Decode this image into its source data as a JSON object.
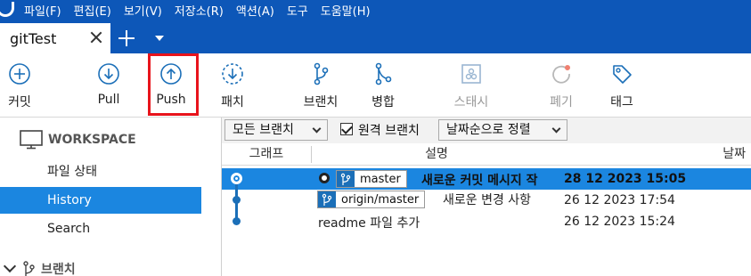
{
  "menu": {
    "items": [
      "파일(F)",
      "편집(E)",
      "보기(V)",
      "저장소(R)",
      "액션(A)",
      "도구",
      "도움말(H)"
    ]
  },
  "tabs": {
    "active_title": "gitTest"
  },
  "toolbar": {
    "commit": "커밋",
    "pull": "Pull",
    "push": "Push",
    "patch": "패치",
    "branch": "브랜치",
    "merge": "병합",
    "stash": "스태시",
    "discard": "폐기",
    "tag": "태그"
  },
  "sidebar": {
    "workspace": "WORKSPACE",
    "items": [
      "파일 상태",
      "History",
      "Search"
    ],
    "selected_index": 1,
    "branches": "브랜치"
  },
  "filter": {
    "branch_filter": "모든 브랜치",
    "remote_branches_label": "원격 브랜치",
    "remote_branches_checked": true,
    "sort": "날짜순으로 정렬"
  },
  "columns": {
    "graph": "그래프",
    "description": "설명",
    "date": "날짜"
  },
  "commits": [
    {
      "branch": "master",
      "message": "새로운 커밋 메시지 작",
      "date": "28 12 2023 15:05",
      "selected": true
    },
    {
      "branch": "origin/master",
      "message": "새로운 변경 사항",
      "date": "26 12 2023 17:54",
      "selected": false
    },
    {
      "branch": "",
      "message": "readme 파일 추가",
      "date": "26 12 2023 15:24",
      "selected": false
    }
  ],
  "colors": {
    "menubar": "#0d57b8",
    "selection": "#1b86e0",
    "highlight": "#e8141c",
    "accent": "#1b6fb8"
  },
  "icons": {
    "commit": "plus-circle-icon",
    "pull": "arrow-down-circle-icon",
    "push": "arrow-up-circle-icon",
    "patch": "dashed-arrow-down-circle-icon",
    "branch": "branch-icon",
    "merge": "merge-icon",
    "stash": "stash-icon",
    "discard": "discard-icon",
    "tag": "tag-icon"
  }
}
